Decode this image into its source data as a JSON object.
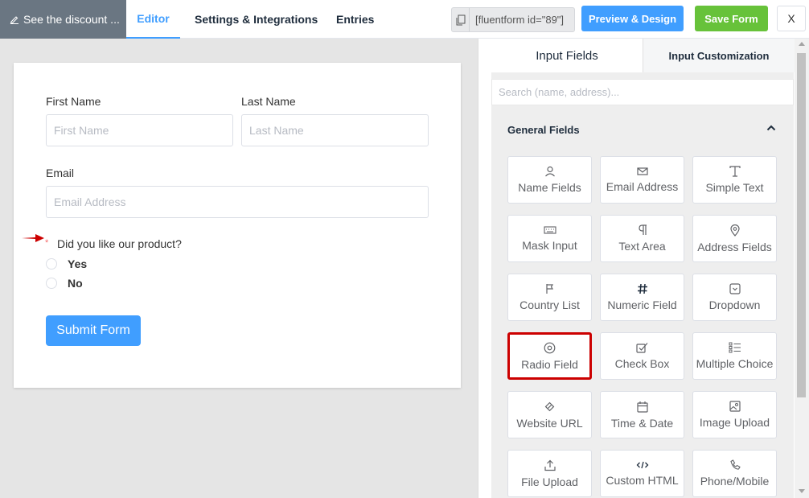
{
  "topbar": {
    "form_name": "See the discount ...",
    "tabs": [
      "Editor",
      "Settings & Integrations",
      "Entries"
    ],
    "shortcode": "[fluentform id=\"89\"]",
    "preview_label": "Preview & Design",
    "save_label": "Save Form",
    "close_label": "X"
  },
  "form": {
    "first_name_label": "First Name",
    "first_name_placeholder": "First Name",
    "last_name_label": "Last Name",
    "last_name_placeholder": "Last Name",
    "email_label": "Email",
    "email_placeholder": "Email Address",
    "required_mark": "*",
    "question_label": "Did you like our product?",
    "options": [
      "Yes",
      "No"
    ],
    "submit_label": "Submit Form"
  },
  "sidebar": {
    "tabs": [
      "Input Fields",
      "Input Customization"
    ],
    "search_placeholder": "Search (name, address)...",
    "group_title": "General Fields",
    "fields": [
      {
        "label": "Name Fields",
        "icon": "user-icon"
      },
      {
        "label": "Email Address",
        "icon": "envelope-icon"
      },
      {
        "label": "Simple Text",
        "icon": "text-icon"
      },
      {
        "label": "Mask Input",
        "icon": "keyboard-icon"
      },
      {
        "label": "Text Area",
        "icon": "paragraph-icon"
      },
      {
        "label": "Address Fields",
        "icon": "map-pin-icon"
      },
      {
        "label": "Country List",
        "icon": "flag-icon"
      },
      {
        "label": "Numeric Field",
        "icon": "hash-icon"
      },
      {
        "label": "Dropdown",
        "icon": "dropdown-icon"
      },
      {
        "label": "Radio Field",
        "icon": "radio-icon"
      },
      {
        "label": "Check Box",
        "icon": "checkbox-icon"
      },
      {
        "label": "Multiple Choice",
        "icon": "list-icon"
      },
      {
        "label": "Website URL",
        "icon": "link-icon"
      },
      {
        "label": "Time & Date",
        "icon": "calendar-icon"
      },
      {
        "label": "Image Upload",
        "icon": "image-icon"
      },
      {
        "label": "File Upload",
        "icon": "upload-icon"
      },
      {
        "label": "Custom HTML",
        "icon": "code-icon"
      },
      {
        "label": "Phone/Mobile",
        "icon": "phone-icon"
      }
    ]
  },
  "colors": {
    "accent": "#409eff",
    "save": "#67c23a",
    "highlight": "#cc0000"
  }
}
